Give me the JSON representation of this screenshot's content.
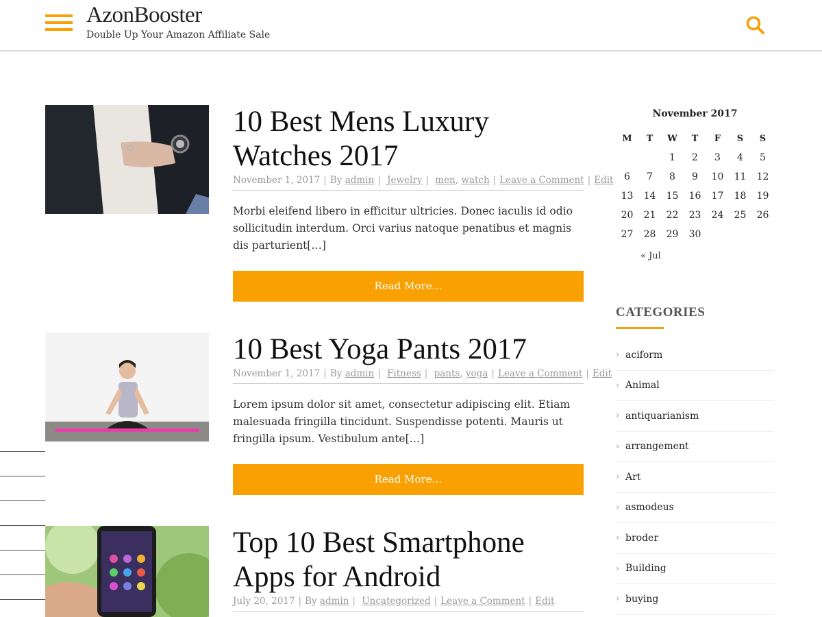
{
  "header": {
    "site_title": "AzonBooster",
    "tagline": "Double Up Your Amazon Affiliate Sale",
    "accent_color": "#f9a002",
    "menu_icon": "hamburger-icon",
    "search_icon": "search-icon"
  },
  "posts": [
    {
      "title": "10 Best Mens Luxury Watches 2017",
      "date": "November 1, 2017",
      "by_label": "By",
      "author": "admin",
      "category": "Jewelry",
      "tag1": "men",
      "tag2": "watch",
      "comment_link": "Leave a Comment",
      "edit_link": "Edit",
      "excerpt": "Morbi eleifend libero in efficitur ultricies. Donec iaculis id odio sollicitudin interdum. Orci varius natoque penatibus et magnis dis parturient[…]",
      "read_more": "Read More…"
    },
    {
      "title": "10 Best Yoga Pants 2017",
      "date": "November 1, 2017",
      "by_label": "By",
      "author": "admin",
      "category": "Fitness",
      "tag1": "pants",
      "tag2": "yoga",
      "comment_link": "Leave a Comment",
      "edit_link": "Edit",
      "excerpt": "Lorem ipsum dolor sit amet, consectetur adipiscing elit. Etiam malesuada fringilla tincidunt. Suspendisse potenti. Mauris ut fringilla ipsum. Vestibulum ante[…]",
      "read_more": "Read More…"
    },
    {
      "title": "Top 10 Best Smartphone Apps for Android",
      "date": "July 20, 2017",
      "by_label": "By",
      "author": "admin",
      "category": "Uncategorized",
      "comment_link": "Leave a Comment",
      "edit_link": "Edit"
    }
  ],
  "calendar": {
    "caption": "November 2017",
    "weekdays": [
      "M",
      "T",
      "W",
      "T",
      "F",
      "S",
      "S"
    ],
    "weeks": [
      [
        "",
        "",
        "1",
        "2",
        "3",
        "4",
        "5"
      ],
      [
        "6",
        "7",
        "8",
        "9",
        "10",
        "11",
        "12"
      ],
      [
        "13",
        "14",
        "15",
        "16",
        "17",
        "18",
        "19"
      ],
      [
        "20",
        "21",
        "22",
        "23",
        "24",
        "25",
        "26"
      ],
      [
        "27",
        "28",
        "29",
        "30",
        "",
        "",
        ""
      ]
    ],
    "prev_link": "« Jul"
  },
  "categories": {
    "title": "CATEGORIES",
    "items": [
      "aciform",
      "Animal",
      "antiquarianism",
      "arrangement",
      "Art",
      "asmodeus",
      "broder",
      "Building",
      "buying"
    ]
  }
}
